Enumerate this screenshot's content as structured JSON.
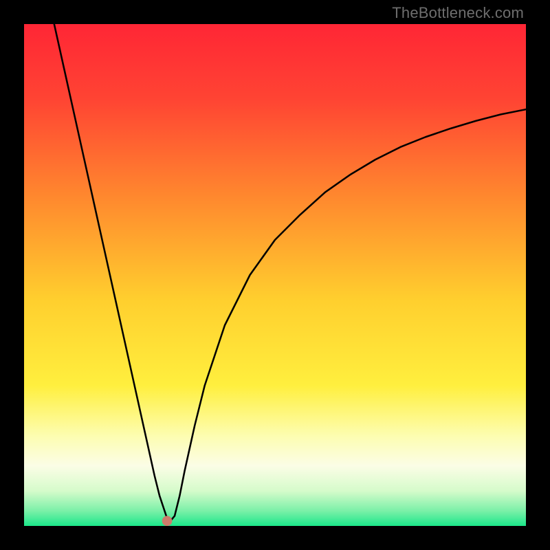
{
  "source_label": "TheBottleneck.com",
  "colors": {
    "frame": "#000000",
    "curve": "#000000",
    "marker": "#cd7c6b",
    "gradient_stops": [
      {
        "offset": 0.0,
        "color": "#ff2635"
      },
      {
        "offset": 0.15,
        "color": "#ff4433"
      },
      {
        "offset": 0.35,
        "color": "#ff8a2e"
      },
      {
        "offset": 0.55,
        "color": "#ffcf2e"
      },
      {
        "offset": 0.72,
        "color": "#ffef3e"
      },
      {
        "offset": 0.82,
        "color": "#fdfdb0"
      },
      {
        "offset": 0.88,
        "color": "#fbfde6"
      },
      {
        "offset": 0.93,
        "color": "#d6fbcb"
      },
      {
        "offset": 0.97,
        "color": "#7bf0a8"
      },
      {
        "offset": 1.0,
        "color": "#1be68a"
      }
    ]
  },
  "chart_data": {
    "type": "line",
    "title": "",
    "xlabel": "",
    "ylabel": "",
    "xlim": [
      0,
      100
    ],
    "ylim": [
      0,
      100
    ],
    "grid": false,
    "legend": false,
    "series": [
      {
        "name": "bottleneck-curve",
        "x": [
          6,
          8,
          10,
          12,
          14,
          16,
          18,
          20,
          22,
          24,
          26,
          27,
          28,
          28.5,
          29,
          30,
          31,
          32,
          34,
          36,
          40,
          45,
          50,
          55,
          60,
          65,
          70,
          75,
          80,
          85,
          90,
          95,
          100
        ],
        "y": [
          100,
          91,
          82,
          73,
          64,
          55,
          46,
          37,
          28,
          19,
          10,
          6,
          3,
          1.5,
          0.8,
          2,
          6,
          11,
          20,
          28,
          40,
          50,
          57,
          62,
          66.5,
          70,
          73,
          75.5,
          77.5,
          79.2,
          80.7,
          82,
          83
        ]
      }
    ],
    "marker": {
      "x": 28.5,
      "y": 1.0,
      "r": 1.0
    }
  }
}
